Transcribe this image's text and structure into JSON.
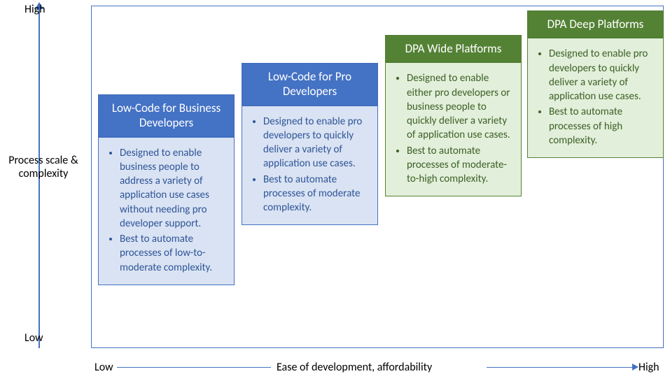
{
  "axes": {
    "y_high": "High",
    "y_low": "Low",
    "y_title": "Process scale & complexity",
    "x_low": "Low",
    "x_high": "High",
    "x_title": "Ease of development, affordability"
  },
  "cards": [
    {
      "title": "Low-Code for Business Developers",
      "bullets": [
        "Designed to enable business people to address a variety of application use cases without needing pro developer support.",
        "Best to automate processes of low-to-moderate complexity."
      ]
    },
    {
      "title": "Low-Code for Pro Developers",
      "bullets": [
        "Designed to enable pro developers to quickly deliver a variety of application use cases.",
        "Best to automate processes of moderate complexity."
      ]
    },
    {
      "title": "DPA Wide Platforms",
      "bullets": [
        "Designed to enable either pro developers or business people to quickly deliver a variety of application use cases.",
        "Best to automate processes of moderate-to-high complexity."
      ]
    },
    {
      "title": "DPA Deep Platforms",
      "bullets": [
        "Designed to enable pro developers to quickly deliver a variety of application use cases.",
        "Best to automate processes of high complexity."
      ]
    }
  ],
  "chart_data": {
    "type": "scatter",
    "title": "",
    "xlabel": "Ease of development, affordability",
    "ylabel": "Process scale & complexity",
    "xlim": [
      "Low",
      "High"
    ],
    "ylim": [
      "Low",
      "High"
    ],
    "series": [
      {
        "name": "Low-Code for Business Developers",
        "x": 1,
        "y": 1,
        "group": "Low-Code",
        "color": "#4472c4"
      },
      {
        "name": "Low-Code for Pro Developers",
        "x": 2,
        "y": 2,
        "group": "Low-Code",
        "color": "#4472c4"
      },
      {
        "name": "DPA Wide Platforms",
        "x": 3,
        "y": 3,
        "group": "DPA",
        "color": "#548235"
      },
      {
        "name": "DPA Deep Platforms",
        "x": 4,
        "y": 4,
        "group": "DPA",
        "color": "#548235"
      }
    ]
  }
}
